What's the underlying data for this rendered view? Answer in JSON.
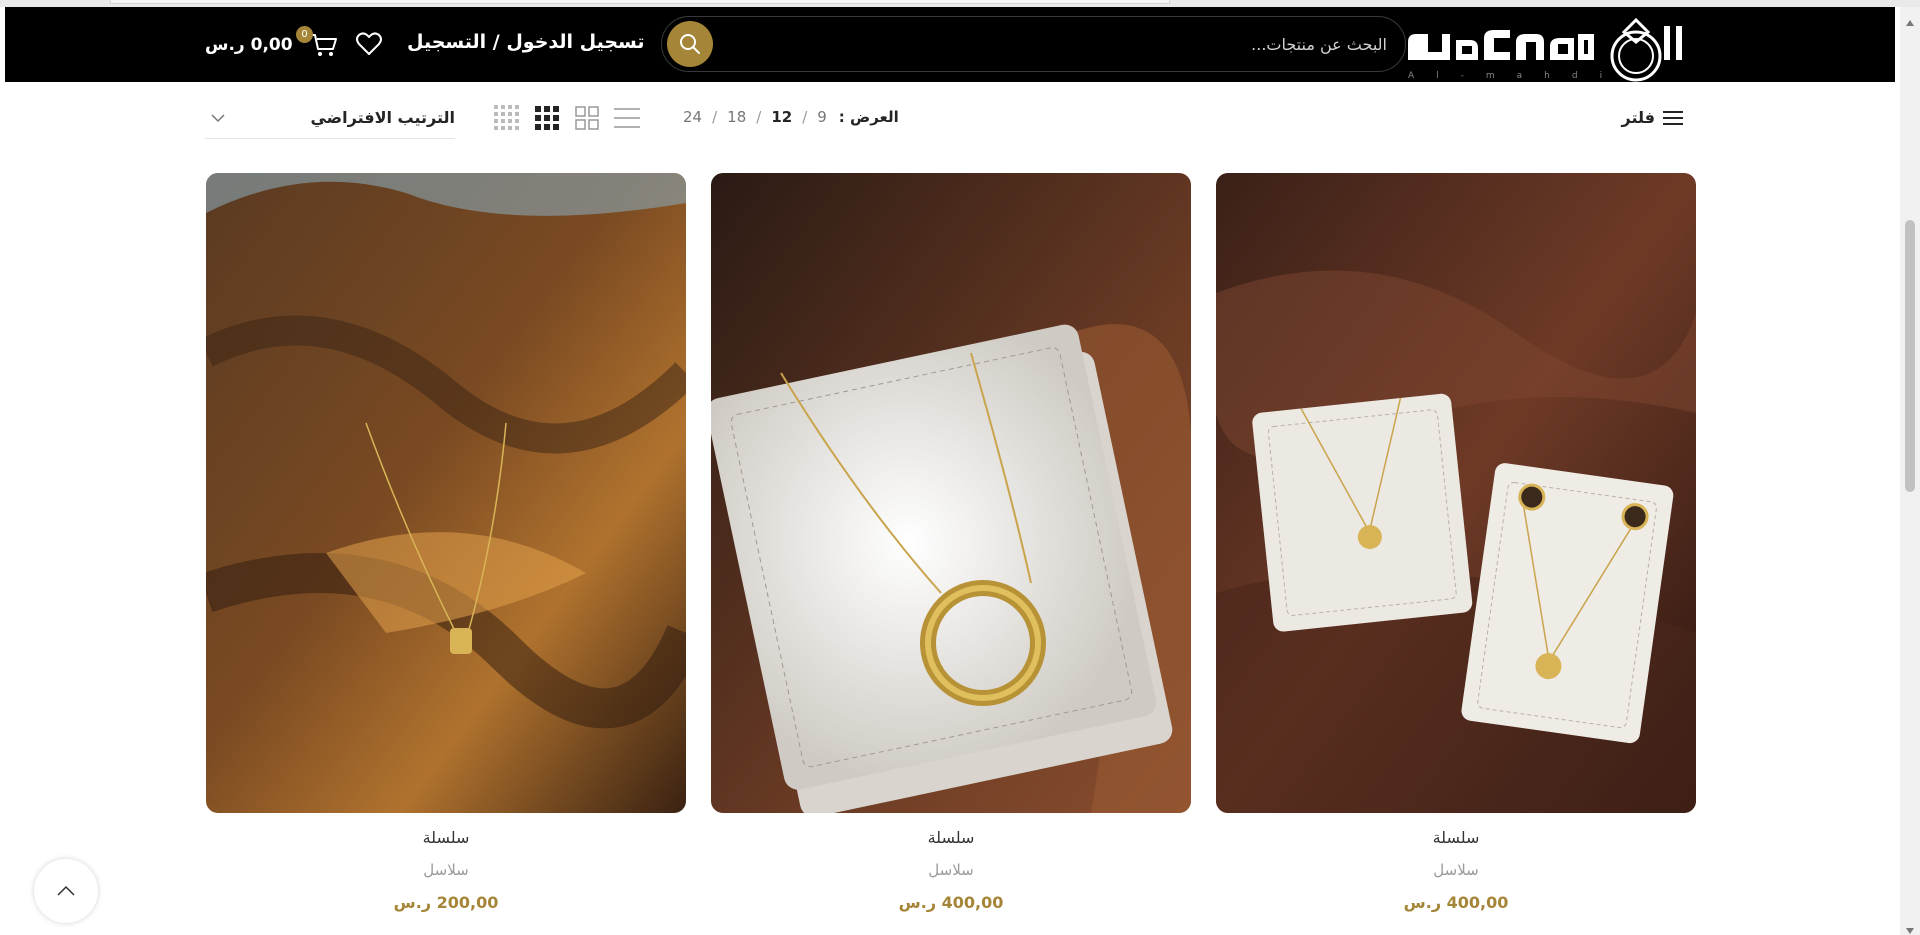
{
  "header": {
    "brand_name": "ال مهدي",
    "brand_latin": "Al-mahdi",
    "search_placeholder": "البحث عن منتجات...",
    "login_label": "تسجيل الدخول / التسجيل",
    "cart_count": "0",
    "cart_total": "0,00 ر.س",
    "colors": {
      "header_bg": "#000000",
      "accent": "#a58537"
    }
  },
  "toolbar": {
    "filter_label": "فلتر",
    "per_page_label": "العرض :",
    "per_page_options": [
      "9",
      "12",
      "18",
      "24"
    ],
    "per_page_active": "12",
    "sort_label": "الترتيب الافتراضي",
    "view_modes": [
      "list-view-icon",
      "grid-2-icon",
      "grid-3-icon",
      "grid-4-icon"
    ],
    "active_view": "grid-3-icon"
  },
  "products": [
    {
      "title": "سلسلة",
      "category": "سلاسل",
      "price": "400,00 ر.س",
      "image": "clover-necklace-set-photo"
    },
    {
      "title": "سلسلة",
      "category": "سلاسل",
      "price": "400,00 ر.س",
      "image": "circle-pendant-necklace-photo"
    },
    {
      "title": "سلسلة",
      "category": "سلاسل",
      "price": "200,00 ر.س",
      "image": "charm-necklace-on-satin-photo"
    }
  ]
}
